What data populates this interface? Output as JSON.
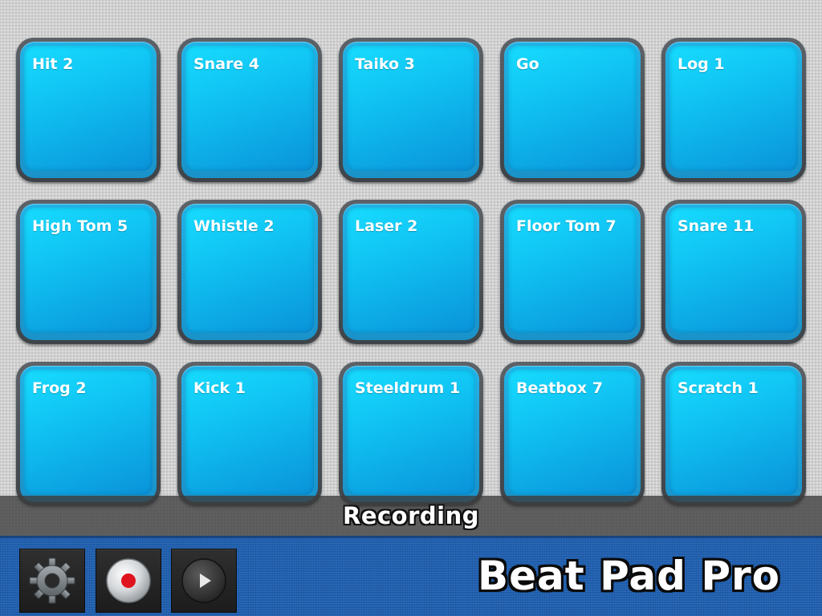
{
  "pads": [
    {
      "label": "Hit 2"
    },
    {
      "label": "Snare 4"
    },
    {
      "label": "Taiko 3"
    },
    {
      "label": "Go"
    },
    {
      "label": "Log 1"
    },
    {
      "label": "High Tom 5"
    },
    {
      "label": "Whistle 2"
    },
    {
      "label": "Laser 2"
    },
    {
      "label": "Floor Tom 7"
    },
    {
      "label": "Snare 11"
    },
    {
      "label": "Frog 2"
    },
    {
      "label": "Kick 1"
    },
    {
      "label": "Steeldrum 1"
    },
    {
      "label": "Beatbox 7"
    },
    {
      "label": "Scratch 1"
    }
  ],
  "status": {
    "text": "Recording"
  },
  "toolbar": {
    "settings_icon": "gear-icon",
    "record_icon": "record-icon",
    "play_icon": "play-icon",
    "logo": "Beat Pad Pro"
  },
  "colors": {
    "pad_face": "#12c8f5",
    "toolbar_bg": "#1f5fb0",
    "record_dot": "#e0141e"
  }
}
